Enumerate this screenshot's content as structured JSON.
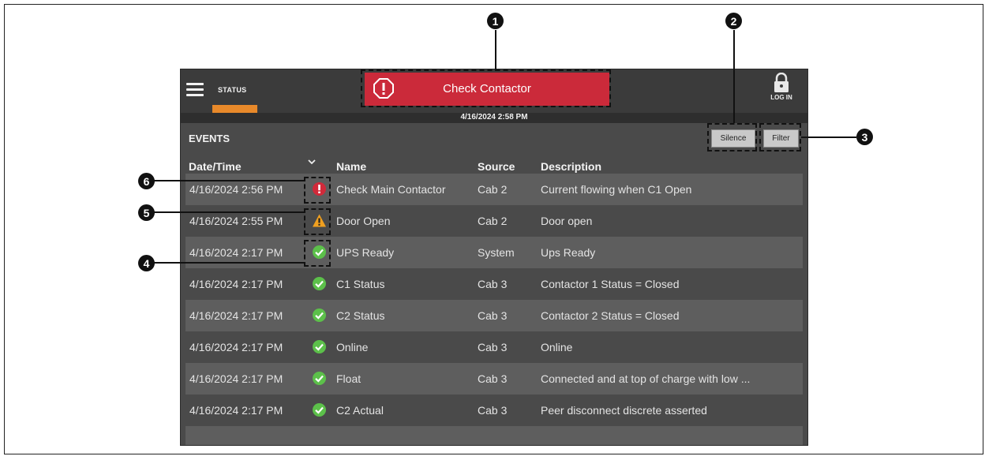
{
  "header": {
    "status_label": "STATUS",
    "alarm_label": "Check Contactor",
    "login_label": "LOG IN",
    "datetime": "4/16/2024 2:58 PM"
  },
  "events": {
    "title": "EVENTS",
    "silence_label": "Silence",
    "filter_label": "Filter",
    "columns": {
      "date": "Date/Time",
      "name": "Name",
      "source": "Source",
      "description": "Description"
    },
    "rows": [
      {
        "date": "4/16/2024 2:56 PM",
        "icon": "alarm-icon",
        "name": "Check Main Contactor",
        "source": "Cab 2",
        "description": "Current flowing when C1 Open"
      },
      {
        "date": "4/16/2024 2:55 PM",
        "icon": "warning-icon",
        "name": "Door Open",
        "source": "Cab 2",
        "description": "Door open"
      },
      {
        "date": "4/16/2024 2:17 PM",
        "icon": "check-icon",
        "name": "UPS Ready",
        "source": "System",
        "description": "Ups Ready"
      },
      {
        "date": "4/16/2024 2:17 PM",
        "icon": "check-icon",
        "name": "C1 Status",
        "source": "Cab 3",
        "description": "Contactor 1 Status = Closed"
      },
      {
        "date": "4/16/2024 2:17 PM",
        "icon": "check-icon",
        "name": "C2 Status",
        "source": "Cab 3",
        "description": "Contactor 2 Status = Closed"
      },
      {
        "date": "4/16/2024 2:17 PM",
        "icon": "check-icon",
        "name": "Online",
        "source": "Cab 3",
        "description": "Online"
      },
      {
        "date": "4/16/2024 2:17 PM",
        "icon": "check-icon",
        "name": "Float",
        "source": "Cab 3",
        "description": "Connected and at top of charge with low ..."
      },
      {
        "date": "4/16/2024 2:17 PM",
        "icon": "check-icon",
        "name": "C2 Actual",
        "source": "Cab 3",
        "description": "Peer disconnect discrete asserted"
      }
    ]
  },
  "callouts": [
    "1",
    "2",
    "3",
    "4",
    "5",
    "6"
  ],
  "colors": {
    "alarm": "#cb2a3a",
    "status_accent": "#e8892a",
    "check": "#5cc04a",
    "warning": "#f0a020"
  }
}
